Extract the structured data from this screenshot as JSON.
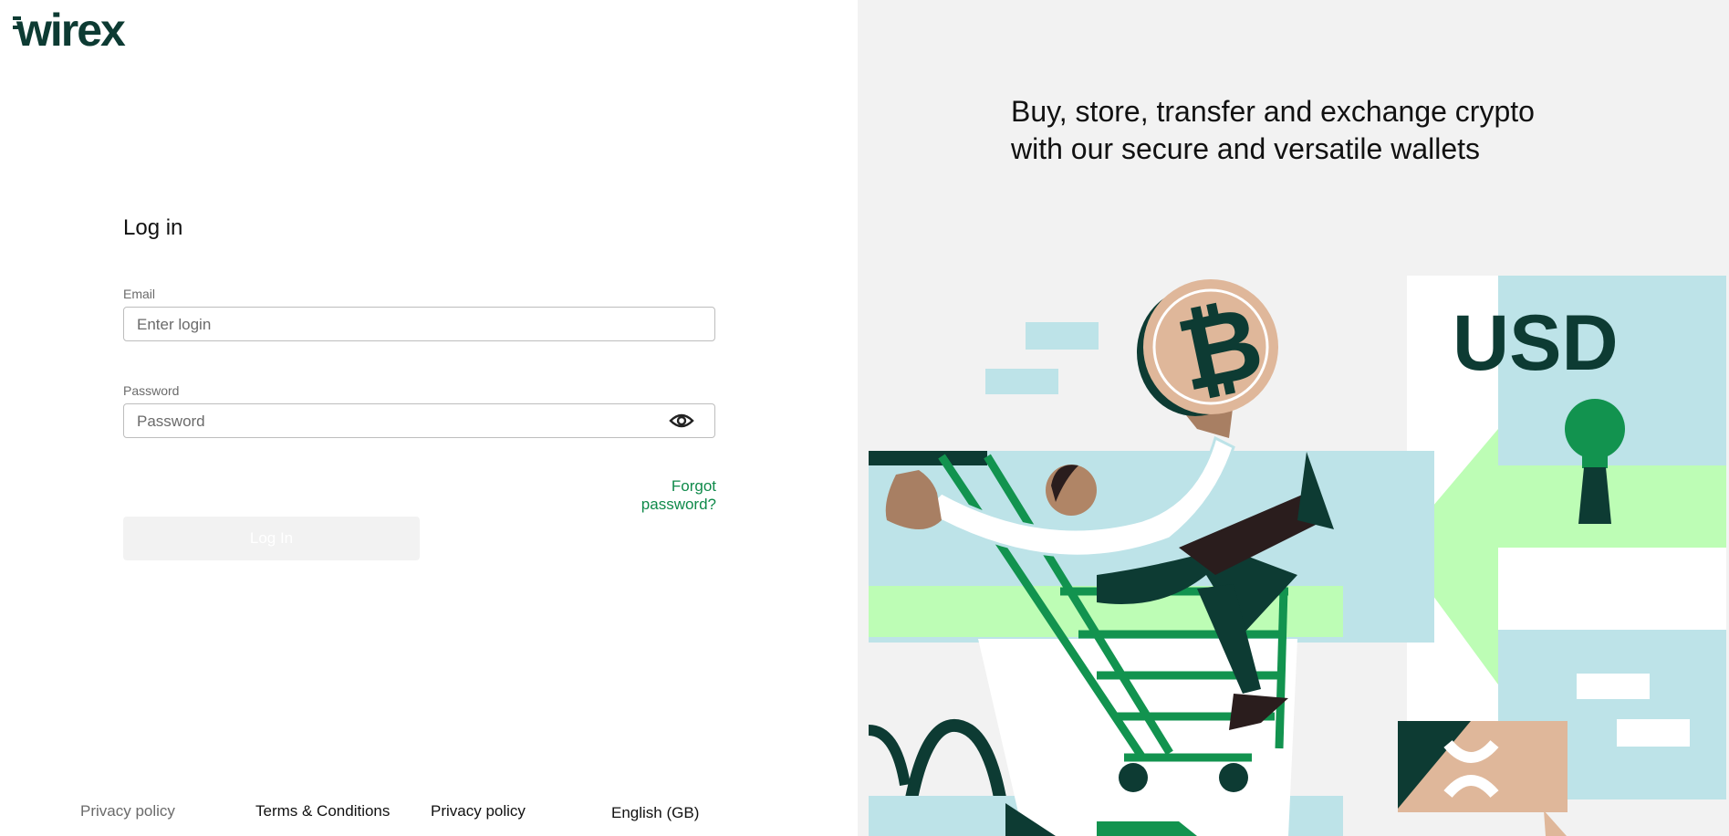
{
  "brand": {
    "logo_text": "wirex",
    "logo_color": "#0d3b33"
  },
  "login": {
    "title": "Log in",
    "email_label": "Email",
    "email_placeholder": "Enter login",
    "email_value": "",
    "password_label": "Password",
    "password_placeholder": "Password",
    "password_value": "",
    "forgot_label": "Forgot password?",
    "submit_label": "Log In"
  },
  "footer": {
    "links": [
      "Privacy policy",
      "Terms & Conditions",
      "Privacy policy"
    ],
    "language": "English (GB)"
  },
  "promo": {
    "headline": "Buy, store, transfer and exchange crypto with our secure and versatile wallets",
    "currency_text": "USD"
  },
  "colors": {
    "brand_dark": "#0d3b33",
    "accent_green": "#0f8a4a",
    "light_green": "#bdfdb5",
    "light_blue": "#bde3e8",
    "coin_beige": "#dfb79a",
    "panel_bg": "#f2f2f2"
  },
  "icons": [
    "eye-icon",
    "bitcoin-coin-icon",
    "keyhole-icon",
    "xrp-icon"
  ]
}
